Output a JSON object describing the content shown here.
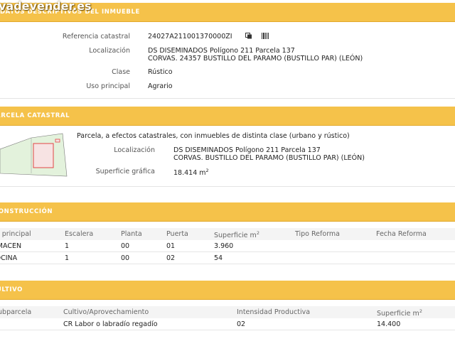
{
  "watermark": "vadevender.es",
  "inmueble": {
    "title": "DATOS DESCRIPTIVOS DEL INMUEBLE",
    "ref_label": "Referencia catastral",
    "ref_value": "24027A211001370000ZI",
    "loc_label": "Localización",
    "loc_line1": "DS DISEMINADOS Polígono 211 Parcela 137",
    "loc_line2": "CORVAS. 24357 BUSTILLO DEL PARAMO (BUSTILLO PAR) (LEÓN)",
    "clase_label": "Clase",
    "clase_value": "Rústico",
    "uso_label": "Uso principal",
    "uso_value": "Agrario",
    "icons": [
      "copy-icon",
      "barcode-icon"
    ]
  },
  "parcela": {
    "title": "PARCELA CATASTRAL",
    "note": "Parcela, a efectos catastrales, con inmuebles de distinta clase (urbano y rústico)",
    "loc_label": "Localización",
    "loc_line1": "DS DISEMINADOS Polígono 211 Parcela 137",
    "loc_line2": "CORVAS. BUSTILLO DEL PARAMO (BUSTILLO PAR) (LEÓN)",
    "sup_label": "Superficie gráfica",
    "sup_value": "18.414 m",
    "sup_unit_exp": "2"
  },
  "construccion": {
    "title": "CONSTRUCCIÓN",
    "headers": {
      "uso": "Uso principal",
      "escalera": "Escalera",
      "planta": "Planta",
      "puerta": "Puerta",
      "superficie": "Superficie m",
      "superficie_exp": "2",
      "tipo": "Tipo Reforma",
      "fecha": "Fecha Reforma"
    },
    "rows": [
      {
        "uso": "ALMACEN",
        "escalera": "1",
        "planta": "00",
        "puerta": "01",
        "superficie": "3.960",
        "tipo": "",
        "fecha": ""
      },
      {
        "uso": "COCINA",
        "escalera": "1",
        "planta": "00",
        "puerta": "02",
        "superficie": "54",
        "tipo": "",
        "fecha": ""
      }
    ]
  },
  "cultivo": {
    "title": "CULTIVO",
    "headers": {
      "subparcela": "Subparcela",
      "cultivo": "Cultivo/Aprovechamiento",
      "intensidad": "Intensidad Productiva",
      "superficie": "Superficie m",
      "superficie_exp": "2"
    },
    "rows": [
      {
        "subparcela": "",
        "cultivo": "CR Labor o labradío regadío",
        "intensidad": "02",
        "superficie": "14.400"
      }
    ]
  },
  "colors": {
    "band": "#f5c24a",
    "plot_border": "#e04646",
    "land": "#dff0d6"
  }
}
